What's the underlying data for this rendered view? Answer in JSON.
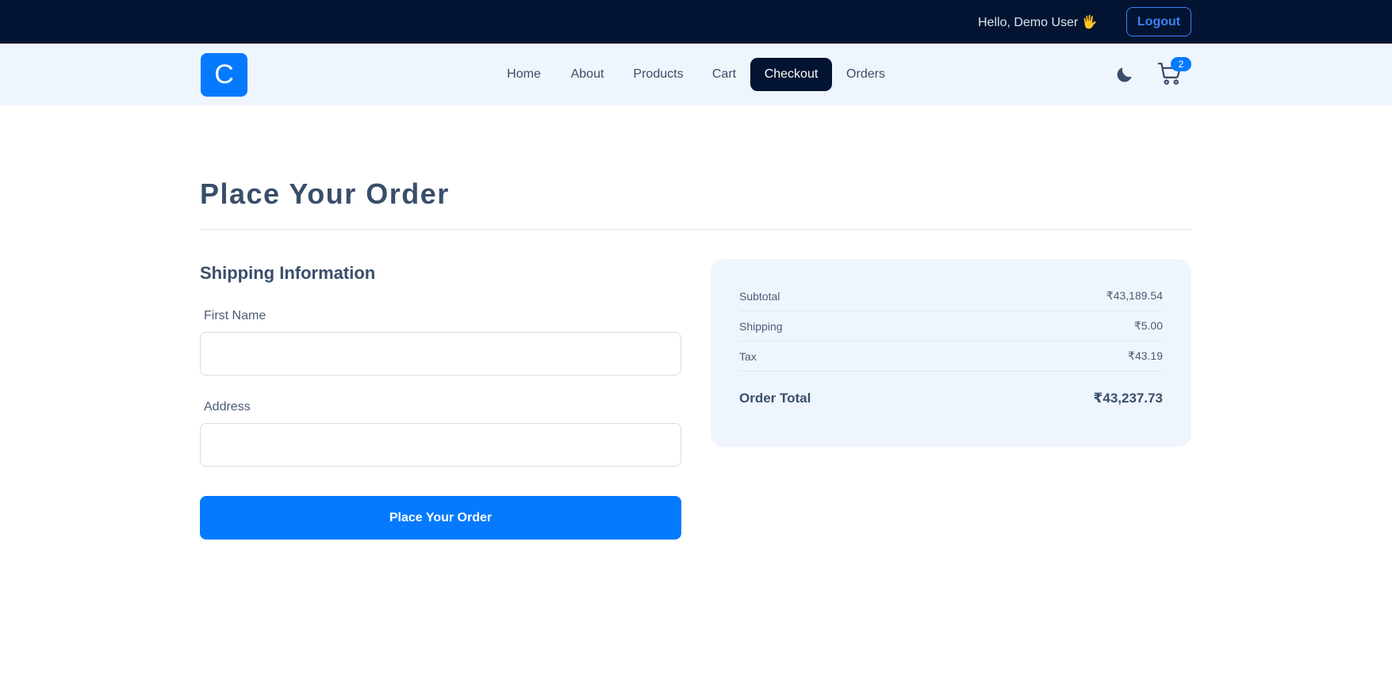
{
  "topbar": {
    "greeting": "Hello, Demo User 🖐",
    "logout_label": "Logout"
  },
  "navbar": {
    "logo_letter": "C",
    "links": [
      {
        "label": "Home"
      },
      {
        "label": "About"
      },
      {
        "label": "Products"
      },
      {
        "label": "Cart"
      },
      {
        "label": "Checkout",
        "active": true
      },
      {
        "label": "Orders"
      }
    ],
    "cart_count": "2",
    "theme_icon": "moon-icon",
    "cart_icon": "cart-icon"
  },
  "page": {
    "title": "Place Your Order"
  },
  "shipping": {
    "heading": "Shipping Information",
    "first_name_label": "First Name",
    "first_name_value": "",
    "address_label": "Address",
    "address_value": "",
    "submit_label": "Place Your Order"
  },
  "summary": {
    "subtotal_label": "Subtotal",
    "subtotal_value": "₹43,189.54",
    "shipping_label": "Shipping",
    "shipping_value": "₹5.00",
    "tax_label": "Tax",
    "tax_value": "₹43.19",
    "total_label": "Order Total",
    "total_value": "₹43,237.73"
  },
  "colors": {
    "topbar_bg": "#021431",
    "accent": "#057aff",
    "navbar_bg": "#eff5fd",
    "text": "#394e6a"
  }
}
